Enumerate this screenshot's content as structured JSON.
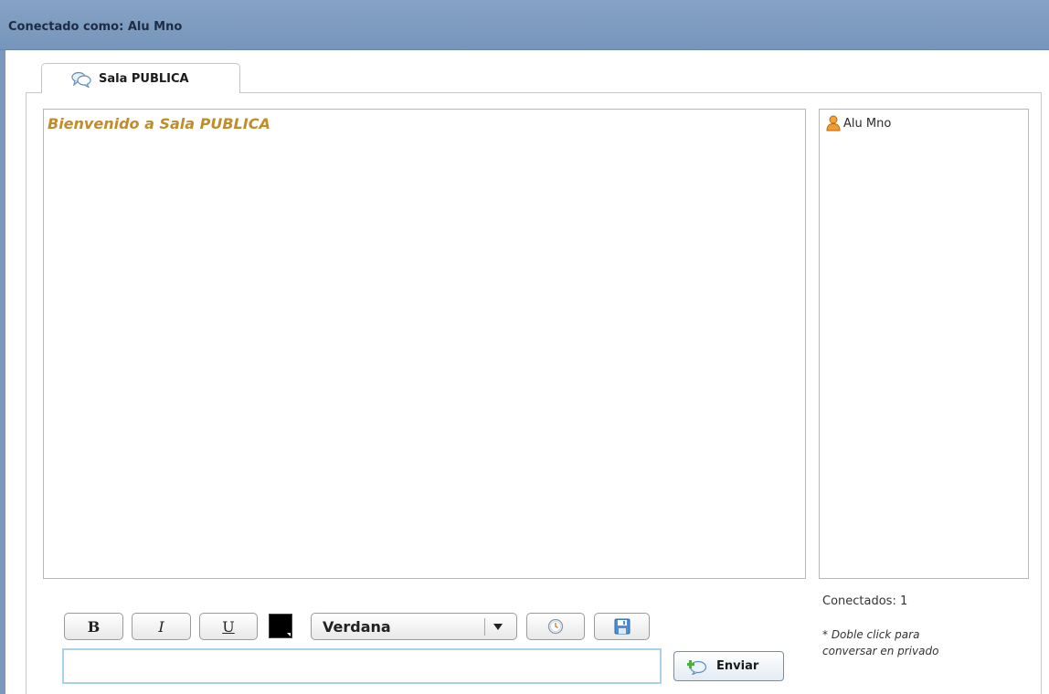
{
  "header": {
    "title": "Conectado como: Alu Mno"
  },
  "tab": {
    "label": "Sala PUBLICA",
    "icon": "chat-bubbles-icon"
  },
  "chat": {
    "welcome": "Bienvenido a Sala PUBLICA",
    "welcome_color": "#c18c2a"
  },
  "users": {
    "items": [
      {
        "name": "Alu Mno",
        "icon": "user-icon"
      }
    ],
    "connected_label": "Conectados: 1",
    "hint_line1": "* Doble click para",
    "hint_line2": "conversar en privado"
  },
  "toolbar": {
    "bold_label": "B",
    "italic_label": "I",
    "underline_label": "U",
    "text_color": "#000000",
    "font": "Verdana",
    "clock_icon": "clock-icon",
    "save_icon": "save-icon"
  },
  "compose": {
    "input_value": "",
    "send_label": "Enviar",
    "send_icon": "add-chat-icon"
  },
  "colors": {
    "header_bg": "#7b98bc",
    "input_border": "#a7d2ea"
  }
}
